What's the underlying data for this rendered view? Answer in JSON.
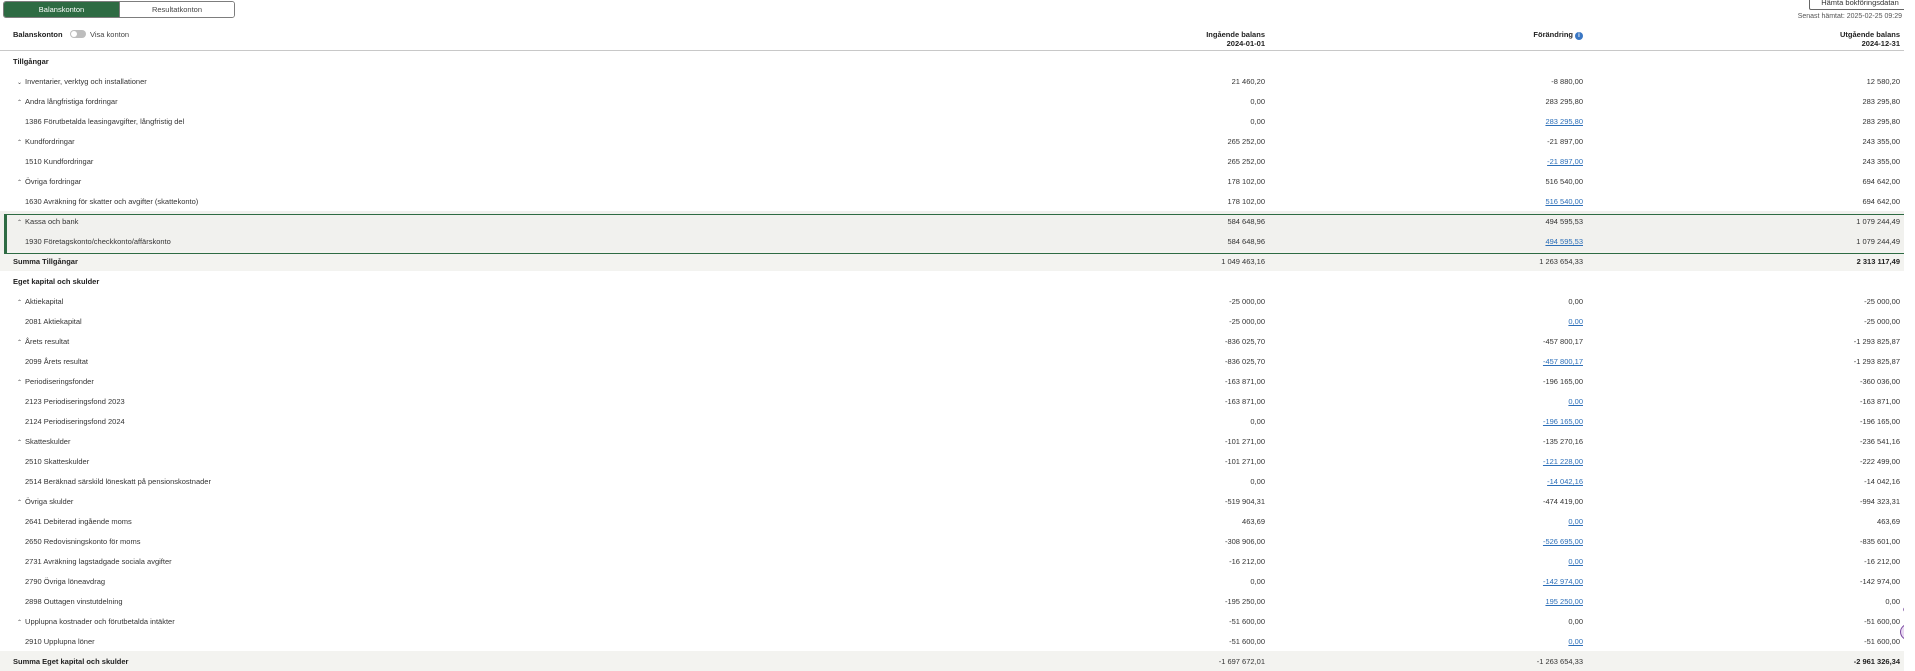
{
  "tabs": [
    {
      "label": "Balanskonton",
      "active": true
    },
    {
      "label": "Resultatkonton",
      "active": false
    }
  ],
  "fetch_button": "Hämta bokföringsdatan",
  "last_fetched": "Senast hämtat: 2025-02-25 09:29",
  "header": {
    "title": "Balanskonton",
    "toggle_label": "Visa konton",
    "col_opening": "Ingående balans",
    "col_opening_date": "2024-01-01",
    "col_change": "Förändring",
    "col_closing": "Utgående balans",
    "col_closing_date": "2024-12-31",
    "info_icon": "i"
  },
  "rows": [
    {
      "type": "section",
      "label": "Tillgångar"
    },
    {
      "type": "group",
      "chevron": "v",
      "label": "Inventarier, verktyg och installationer",
      "opening": "21 460,20",
      "change": "-8 880,00",
      "closing": "12 580,20"
    },
    {
      "type": "group",
      "chevron": "^",
      "label": "Andra långfristiga fordringar",
      "opening": "0,00",
      "change": "283 295,80",
      "closing": "283 295,80"
    },
    {
      "type": "account",
      "label": "1386 Förutbetalda leasingavgifter, långfristig del",
      "opening": "0,00",
      "change": "283 295,80",
      "closing": "283 295,80",
      "link": true
    },
    {
      "type": "group",
      "chevron": "^",
      "label": "Kundfordringar",
      "opening": "265 252,00",
      "change": "-21 897,00",
      "closing": "243 355,00"
    },
    {
      "type": "account",
      "label": "1510 Kundfordringar",
      "opening": "265 252,00",
      "change": "-21 897,00",
      "closing": "243 355,00",
      "link": true
    },
    {
      "type": "group",
      "chevron": "^",
      "label": "Övriga fordringar",
      "opening": "178 102,00",
      "change": "516 540,00",
      "closing": "694 642,00"
    },
    {
      "type": "account",
      "label": "1630 Avräkning för skatter och avgifter (skattekonto)",
      "opening": "178 102,00",
      "change": "516 540,00",
      "closing": "694 642,00",
      "link": true
    },
    {
      "type": "group",
      "chevron": "^",
      "label": "Kassa och bank",
      "opening": "584 648,96",
      "change": "494 595,53",
      "closing": "1 079 244,49",
      "highlight": true
    },
    {
      "type": "account",
      "label": "1930 Företagskonto/checkkonto/affärskonto",
      "opening": "584 648,96",
      "change": "494 595,53",
      "closing": "1 079 244,49",
      "link": true,
      "highlight": true
    },
    {
      "type": "sum",
      "label": "Summa Tillgångar",
      "opening": "1 049 463,16",
      "change": "1 263 654,33",
      "closing": "2 313 117,49"
    },
    {
      "type": "section",
      "label": "Eget kapital och skulder"
    },
    {
      "type": "group",
      "chevron": "^",
      "label": "Aktiekapital",
      "opening": "-25 000,00",
      "change": "0,00",
      "closing": "-25 000,00"
    },
    {
      "type": "account",
      "label": "2081 Aktiekapital",
      "opening": "-25 000,00",
      "change": "0,00",
      "closing": "-25 000,00",
      "link": true
    },
    {
      "type": "group",
      "chevron": "^",
      "label": "Årets resultat",
      "opening": "-836 025,70",
      "change": "-457 800,17",
      "closing": "-1 293 825,87"
    },
    {
      "type": "account",
      "label": "2099 Årets resultat",
      "opening": "-836 025,70",
      "change": "-457 800,17",
      "closing": "-1 293 825,87",
      "link": true
    },
    {
      "type": "group",
      "chevron": "^",
      "label": "Periodiseringsfonder",
      "opening": "-163 871,00",
      "change": "-196 165,00",
      "closing": "-360 036,00"
    },
    {
      "type": "account",
      "label": "2123 Periodiseringsfond 2023",
      "opening": "-163 871,00",
      "change": "0,00",
      "closing": "-163 871,00",
      "link": true
    },
    {
      "type": "account",
      "label": "2124 Periodiseringsfond 2024",
      "opening": "0,00",
      "change": "-196 165,00",
      "closing": "-196 165,00",
      "link": true
    },
    {
      "type": "group",
      "chevron": "^",
      "label": "Skatteskulder",
      "opening": "-101 271,00",
      "change": "-135 270,16",
      "closing": "-236 541,16"
    },
    {
      "type": "account",
      "label": "2510 Skatteskulder",
      "opening": "-101 271,00",
      "change": "-121 228,00",
      "closing": "-222 499,00",
      "link": true
    },
    {
      "type": "account",
      "label": "2514 Beräknad särskild löneskatt på pensionskostnader",
      "opening": "0,00",
      "change": "-14 042,16",
      "closing": "-14 042,16",
      "link": true
    },
    {
      "type": "group",
      "chevron": "^",
      "label": "Övriga skulder",
      "opening": "-519 904,31",
      "change": "-474 419,00",
      "closing": "-994 323,31"
    },
    {
      "type": "account",
      "label": "2641 Debiterad ingående moms",
      "opening": "463,69",
      "change": "0,00",
      "closing": "463,69",
      "link": true
    },
    {
      "type": "account",
      "label": "2650 Redovisningskonto för moms",
      "opening": "-308 906,00",
      "change": "-526 695,00",
      "closing": "-835 601,00",
      "link": true
    },
    {
      "type": "account",
      "label": "2731 Avräkning lagstadgade sociala avgifter",
      "opening": "-16 212,00",
      "change": "0,00",
      "closing": "-16 212,00",
      "link": true
    },
    {
      "type": "account",
      "label": "2790 Övriga löneavdrag",
      "opening": "0,00",
      "change": "-142 974,00",
      "closing": "-142 974,00",
      "link": true
    },
    {
      "type": "account",
      "label": "2898 Outtagen vinstutdelning",
      "opening": "-195 250,00",
      "change": "195 250,00",
      "closing": "0,00",
      "link": true
    },
    {
      "type": "group",
      "chevron": "^",
      "label": "Upplupna kostnader och förutbetalda intäkter",
      "opening": "-51 600,00",
      "change": "0,00",
      "closing": "-51 600,00"
    },
    {
      "type": "account",
      "label": "2910 Upplupna löner",
      "opening": "-51 600,00",
      "change": "0,00",
      "closing": "-51 600,00",
      "link": true
    },
    {
      "type": "sum",
      "label": "Summa Eget kapital och skulder",
      "opening": "-1 697 672,01",
      "change": "-1 263 654,33",
      "closing": "-2 961 326,34"
    }
  ]
}
